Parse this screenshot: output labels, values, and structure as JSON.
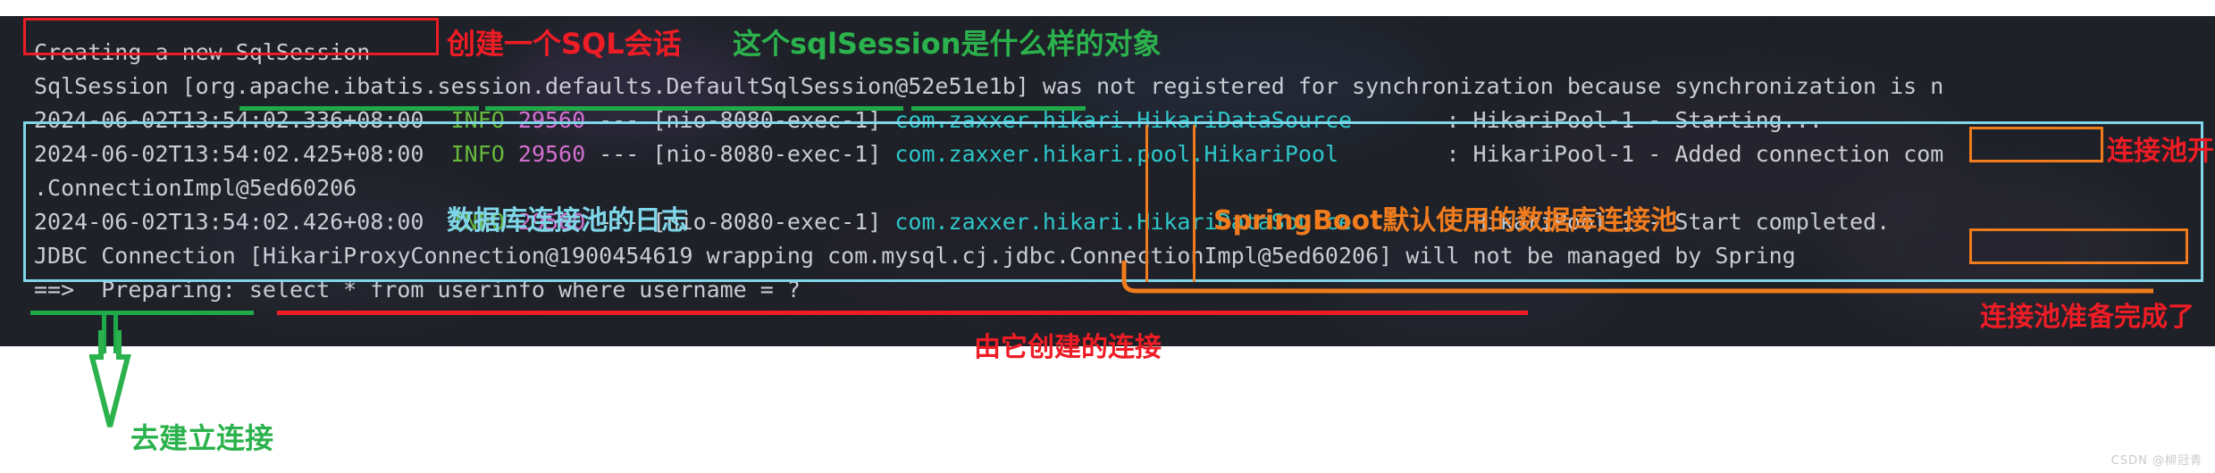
{
  "terminal": {
    "lines": [
      {
        "id": "line-creating-session",
        "segments": [
          {
            "text": "Creating a new SqlSession",
            "color": "grey"
          }
        ]
      },
      {
        "id": "line-sqlsession-object",
        "segments": [
          {
            "text": "SqlSession [org.apache.ibatis.session.defaults.DefaultSqlSession@52e51e1b] was not registered for synchronization because synchronization is n",
            "color": "grey"
          }
        ]
      },
      {
        "id": "line-hikari-starting",
        "segments": [
          {
            "text": "2024-06-02T13:54:02.336+08:00",
            "color": "grey"
          },
          {
            "text": "  ",
            "color": "grey"
          },
          {
            "text": "INFO",
            "color": "green"
          },
          {
            "text": " ",
            "color": "grey"
          },
          {
            "text": "29560",
            "color": "pink"
          },
          {
            "text": " --- [nio-8080-exec-1] ",
            "color": "grey"
          },
          {
            "text": "com.zaxxer.hikari.HikariDataSource",
            "color": "cyan"
          },
          {
            "text": "       : HikariPool-1 - Starting...",
            "color": "grey"
          }
        ]
      },
      {
        "id": "line-hikari-added-connection",
        "segments": [
          {
            "text": "2024-06-02T13:54:02.425+08:00",
            "color": "grey"
          },
          {
            "text": "  ",
            "color": "grey"
          },
          {
            "text": "INFO",
            "color": "green"
          },
          {
            "text": " ",
            "color": "grey"
          },
          {
            "text": "29560",
            "color": "pink"
          },
          {
            "text": " --- [nio-8080-exec-1] ",
            "color": "grey"
          },
          {
            "text": "com.zaxxer.hikari.pool.HikariPool",
            "color": "cyan"
          },
          {
            "text": "        : HikariPool-1 - Added connection com",
            "color": "grey"
          }
        ]
      },
      {
        "id": "line-connection-impl",
        "segments": [
          {
            "text": ".ConnectionImpl@5ed60206",
            "color": "grey"
          }
        ]
      },
      {
        "id": "line-hikari-start-completed",
        "segments": [
          {
            "text": "2024-06-02T13:54:02.426+08:00",
            "color": "grey"
          },
          {
            "text": "  ",
            "color": "grey"
          },
          {
            "text": "INFO",
            "color": "green"
          },
          {
            "text": " ",
            "color": "grey"
          },
          {
            "text": "29560",
            "color": "pink"
          },
          {
            "text": " --- [nio-8080-exec-1] ",
            "color": "grey"
          },
          {
            "text": "com.zaxxer.hikari.HikariDataSource",
            "color": "cyan"
          },
          {
            "text": "       : HikariPool-1 - Start completed.",
            "color": "grey"
          }
        ]
      },
      {
        "id": "line-jdbc-connection",
        "segments": [
          {
            "text": "JDBC Connection [HikariProxyConnection@1900454619 wrapping com.mysql.cj.jdbc.ConnectionImpl@5ed60206] will not be managed by Spring",
            "color": "grey"
          }
        ]
      },
      {
        "id": "line-preparing-sql",
        "segments": [
          {
            "text": "==>  Preparing: select * from userinfo where username = ?",
            "color": "grey"
          }
        ]
      }
    ]
  },
  "annotations": {
    "creating_session_cn": "创建一个SQL会话",
    "what_kind_of_object_cn": "这个sqlSession是什么样的对象",
    "pool_starting_cn": "连接池开始准备",
    "datasource_log_cn": "数据库连接池的日志",
    "springboot_default_pool_cn": "SpringBoot默认使用的数据库连接池",
    "pool_ready_cn": "连接池准备完成了",
    "created_by_it_cn": "由它创建的连接",
    "go_build_connection_cn": "去建立连接"
  },
  "watermark": {
    "text": "CSDN @柳冠青"
  },
  "colors": {
    "red": "#ee1c25",
    "green": "#2bb24c",
    "cyan": "#7fd6e8",
    "orange": "#f07c1d",
    "terminal_bg": "#1e2127",
    "terminal_fg": "#c9ccd4"
  }
}
